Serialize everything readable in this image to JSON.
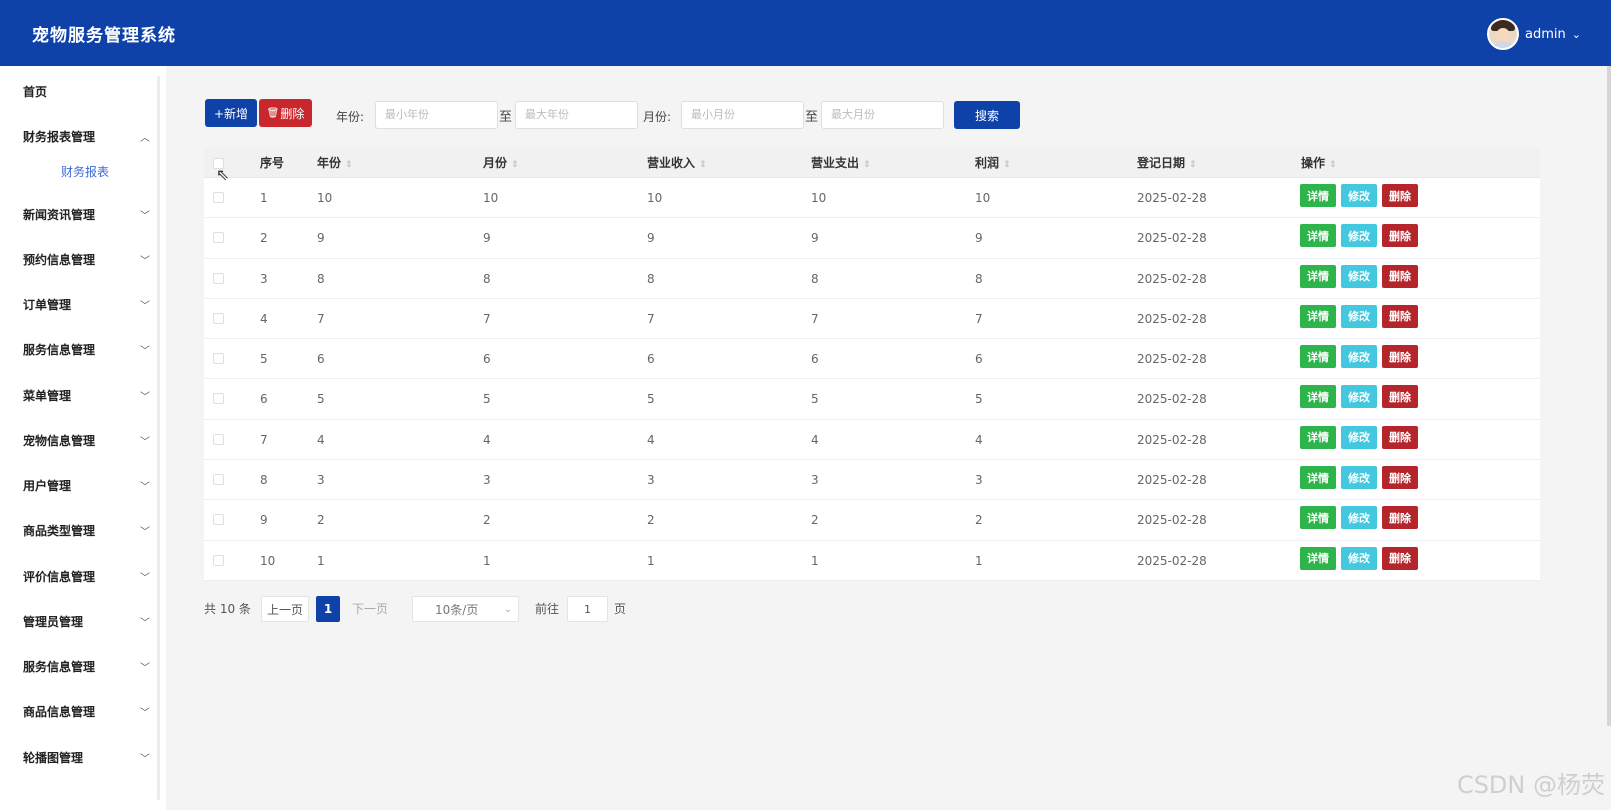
{
  "header": {
    "title": "宠物服务管理系统",
    "user": "admin"
  },
  "sidebar": {
    "items": [
      {
        "label": "首页",
        "arrow": ""
      },
      {
        "label": "财务报表管理",
        "arrow": "^"
      },
      {
        "label": "新闻资讯管理",
        "arrow": "v"
      },
      {
        "label": "预约信息管理",
        "arrow": "v"
      },
      {
        "label": "订单管理",
        "arrow": "v"
      },
      {
        "label": "服务信息管理",
        "arrow": "v"
      },
      {
        "label": "菜单管理",
        "arrow": "v"
      },
      {
        "label": "宠物信息管理",
        "arrow": "v"
      },
      {
        "label": "用户管理",
        "arrow": "v"
      },
      {
        "label": "商品类型管理",
        "arrow": "v"
      },
      {
        "label": "评价信息管理",
        "arrow": "v"
      },
      {
        "label": "管理员管理",
        "arrow": "v"
      },
      {
        "label": "服务信息管理",
        "arrow": "v"
      },
      {
        "label": "商品信息管理",
        "arrow": "v"
      },
      {
        "label": "轮播图管理",
        "arrow": "v"
      }
    ],
    "submenu": {
      "label": "财务报表"
    }
  },
  "toolbar": {
    "add_label": "+新增",
    "delete_label": "删除",
    "year_label": "年份:",
    "year_min_placeholder": "最小年份",
    "to1": "至",
    "year_max_placeholder": "最大年份",
    "month_label": "月份:",
    "month_min_placeholder": "最小月份",
    "to2": "至",
    "month_max_placeholder": "最大月份",
    "search_label": "搜索"
  },
  "table": {
    "columns": [
      "序号",
      "年份",
      "月份",
      "营业收入",
      "营业支出",
      "利润",
      "登记日期",
      "操作"
    ],
    "rows": [
      [
        "1",
        "10",
        "10",
        "10",
        "10",
        "10",
        "2025-02-28"
      ],
      [
        "2",
        "9",
        "9",
        "9",
        "9",
        "9",
        "2025-02-28"
      ],
      [
        "3",
        "8",
        "8",
        "8",
        "8",
        "8",
        "2025-02-28"
      ],
      [
        "4",
        "7",
        "7",
        "7",
        "7",
        "7",
        "2025-02-28"
      ],
      [
        "5",
        "6",
        "6",
        "6",
        "6",
        "6",
        "2025-02-28"
      ],
      [
        "6",
        "5",
        "5",
        "5",
        "5",
        "5",
        "2025-02-28"
      ],
      [
        "7",
        "4",
        "4",
        "4",
        "4",
        "4",
        "2025-02-28"
      ],
      [
        "8",
        "3",
        "3",
        "3",
        "3",
        "3",
        "2025-02-28"
      ],
      [
        "9",
        "2",
        "2",
        "2",
        "2",
        "2",
        "2025-02-28"
      ],
      [
        "10",
        "1",
        "1",
        "1",
        "1",
        "1",
        "2025-02-28"
      ]
    ],
    "actions": {
      "detail": "详情",
      "edit": "修改",
      "delete": "删除"
    }
  },
  "pagination": {
    "total": "共 10 条",
    "prev": "上一页",
    "current": "1",
    "next": "下一页",
    "page_size": "10条/页",
    "goto_label": "前往",
    "goto_value": "1",
    "page_suffix": "页"
  },
  "watermark": "CSDN @杨荧",
  "colors": {
    "primary": "#0f42a8",
    "danger": "#c8282d",
    "success": "#2db44a",
    "info": "#43c8e0"
  }
}
